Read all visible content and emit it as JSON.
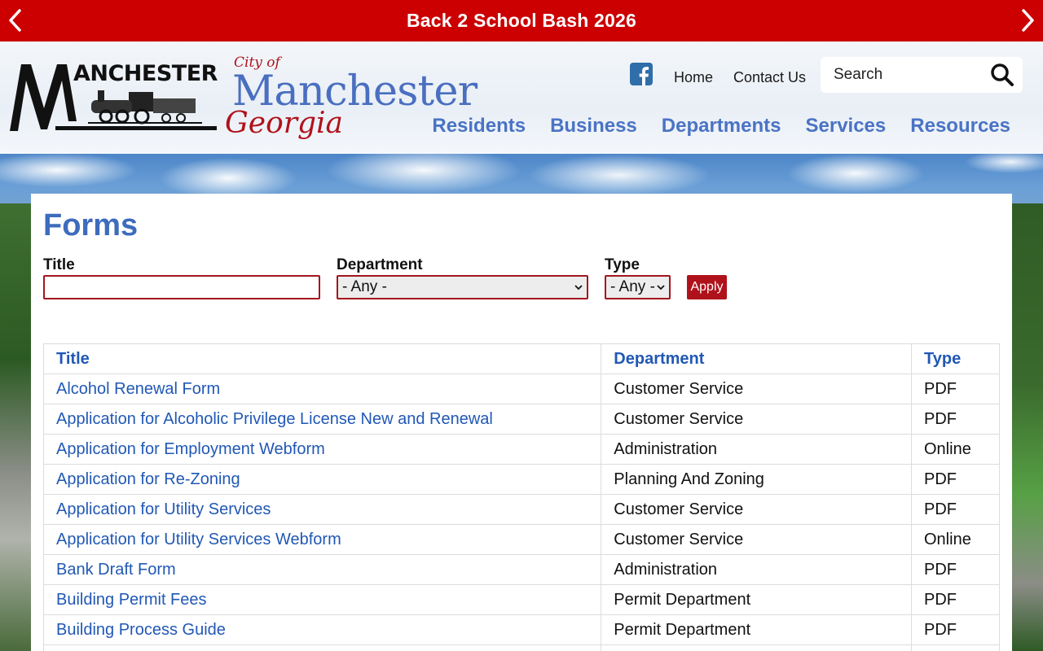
{
  "announcement": {
    "title": "Back 2 School Bash 2026",
    "prev_icon": "chevron-left-icon",
    "next_icon": "chevron-right-icon"
  },
  "header": {
    "logo_text": "ANCHESTER",
    "brand": {
      "city_of": "City of",
      "name": "Manchester",
      "state": "Georgia"
    },
    "utility_links": {
      "facebook_icon": "facebook-icon",
      "home": "Home",
      "contact": "Contact Us"
    },
    "search": {
      "placeholder": "Search",
      "value": ""
    },
    "nav": [
      "Residents",
      "Business",
      "Departments",
      "Services",
      "Resources"
    ]
  },
  "colors": {
    "topbar": "#cc0000",
    "brand_blue": "#4a6fc0",
    "brand_red": "#b0121b",
    "link_blue": "#2158b5"
  },
  "page": {
    "title": "Forms",
    "filters": {
      "title_label": "Title",
      "title_value": "",
      "department_label": "Department",
      "department_selected": "- Any -",
      "type_label": "Type",
      "type_selected": "- Any -",
      "apply_label": "Apply"
    },
    "table": {
      "headers": [
        "Title",
        "Department",
        "Type"
      ],
      "rows": [
        {
          "title": "Alcohol Renewal Form",
          "department": "Customer Service",
          "type": "PDF"
        },
        {
          "title": "Application for Alcoholic Privilege License New and Renewal",
          "department": "Customer Service",
          "type": "PDF"
        },
        {
          "title": "Application for Employment Webform",
          "department": "Administration",
          "type": "Online"
        },
        {
          "title": "Application for Re-Zoning",
          "department": "Planning And Zoning",
          "type": "PDF"
        },
        {
          "title": "Application for Utility Services",
          "department": "Customer Service",
          "type": "PDF"
        },
        {
          "title": "Application for Utility Services Webform",
          "department": "Customer Service",
          "type": "Online"
        },
        {
          "title": "Bank Draft Form",
          "department": "Administration",
          "type": "PDF"
        },
        {
          "title": "Building Permit Fees",
          "department": "Permit Department",
          "type": "PDF"
        },
        {
          "title": "Building Process Guide",
          "department": "Permit Department",
          "type": "PDF"
        }
      ]
    }
  }
}
